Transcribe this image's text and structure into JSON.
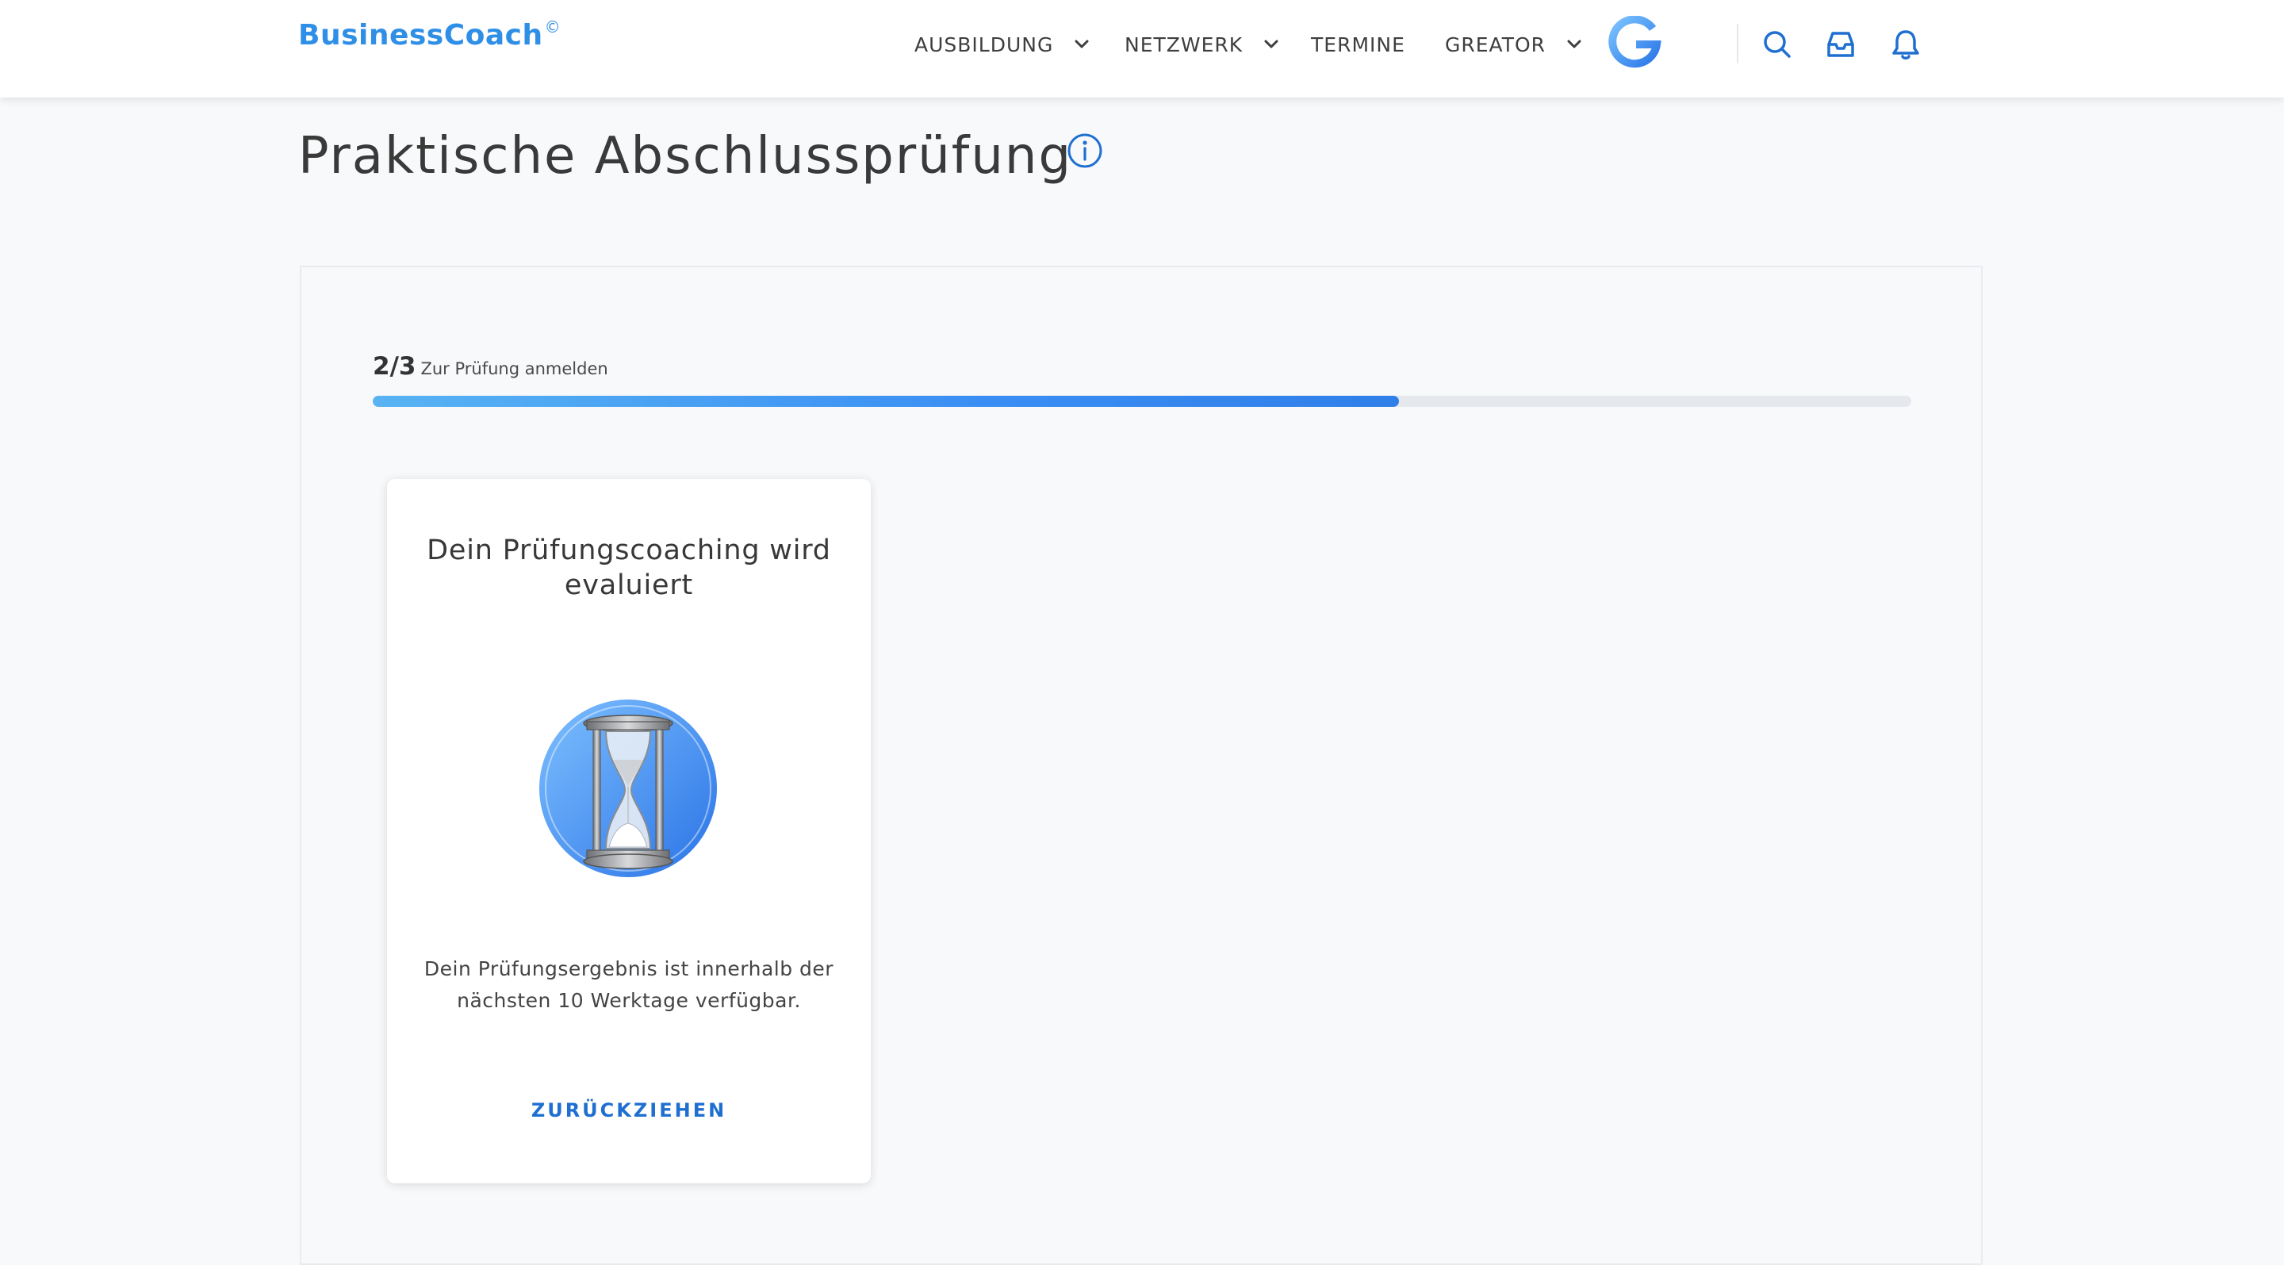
{
  "header": {
    "logo_text": "BusinessCoach",
    "logo_mark": "©",
    "nav": [
      {
        "label": "AUSBILDUNG",
        "has_dropdown": true
      },
      {
        "label": "NETZWERK",
        "has_dropdown": true
      },
      {
        "label": "TERMINE",
        "has_dropdown": false
      },
      {
        "label": "GREATOR",
        "has_dropdown": true
      }
    ],
    "icons": [
      "g-logo",
      "search-icon",
      "inbox-icon",
      "bell-icon"
    ]
  },
  "page": {
    "title": "Praktische Abschlussprüfung",
    "info_icon": "info-icon"
  },
  "progress": {
    "step": "2/3",
    "label": "Zur Prüfung anmelden",
    "fraction": 0.667
  },
  "card": {
    "title": "Dein Prüfungscoaching wird evaluiert",
    "image": "hourglass-icon",
    "body": "Dein Prüfungsergebnis ist innerhalb der nächsten 10 Werktage verfügbar.",
    "action_label": "ZURÜCKZIEHEN"
  },
  "colors": {
    "accent": "#1f6fd1",
    "logo": "#2f8fe6",
    "progress_start": "#58b3f3",
    "progress_end": "#2f7fe8",
    "background": "#f7f9fb"
  }
}
